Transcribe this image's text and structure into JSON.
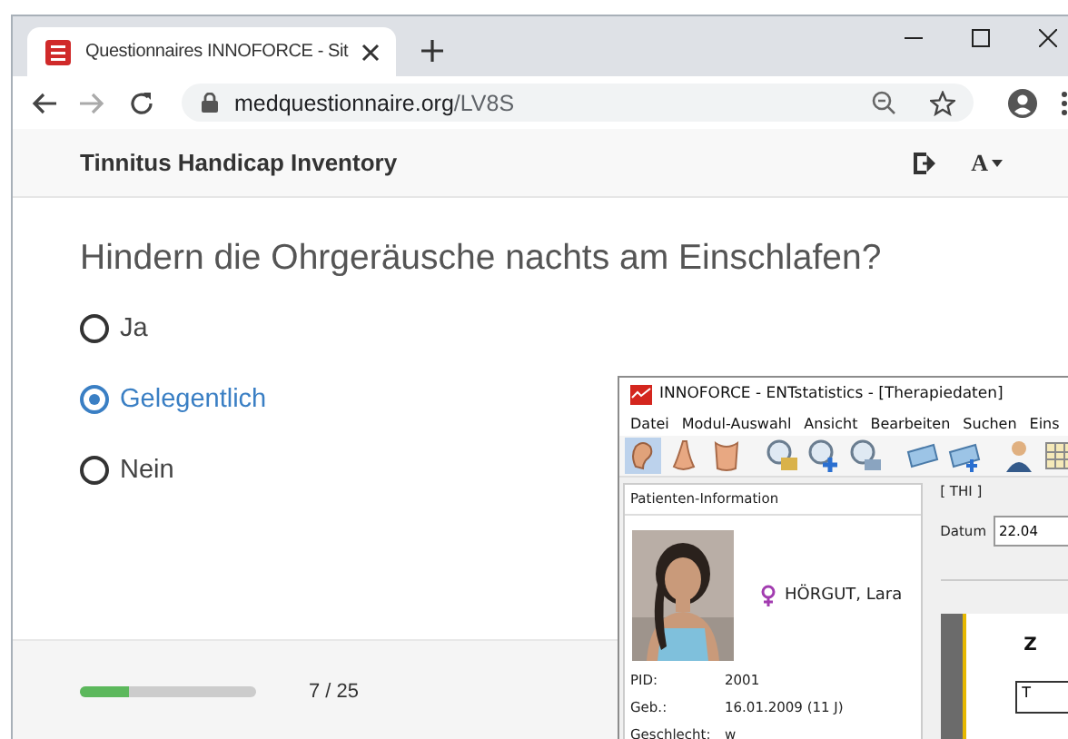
{
  "browser": {
    "tab": {
      "title": "Questionnaires INNOFORCE - Sit"
    },
    "address": {
      "domain": "medquestionnaire.org",
      "path": "/LV8S"
    }
  },
  "header": {
    "title": "Tinnitus Handicap Inventory",
    "text_size_button": "A"
  },
  "question": {
    "text": "Hindern die Ohrgeräusche nachts am Einschlafen?",
    "options": [
      {
        "label": "Ja",
        "selected": false
      },
      {
        "label": "Gelegentlich",
        "selected": true
      },
      {
        "label": "Nein",
        "selected": false
      }
    ]
  },
  "progress": {
    "level": 0.28,
    "reading": "7 / 25"
  },
  "app_window": {
    "title": "INNOFORCE - ENTstatistics  - [Therapiedaten]",
    "menu": [
      "Datei",
      "Modul-Auswahl",
      "Ansicht",
      "Bearbeiten",
      "Suchen",
      "Eins"
    ],
    "patient_panel": {
      "title": "Patienten-Information",
      "name": "HÖRGUT, Lara",
      "fields": [
        {
          "label": "PID:",
          "value": "2001"
        },
        {
          "label": "Geb.:",
          "value": "16.01.2009 (11 J)"
        },
        {
          "label": "Geschlecht:",
          "value": "w"
        }
      ]
    },
    "thi_panel": {
      "title": "[ THI ]",
      "date_label": "Datum",
      "date_value": "22.04",
      "document": {
        "heading": "Z",
        "cell": "T"
      }
    }
  }
}
